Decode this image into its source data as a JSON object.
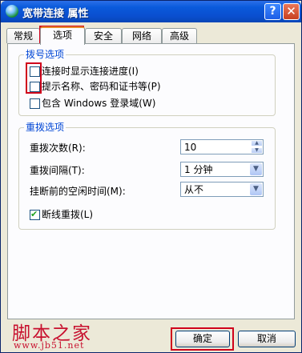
{
  "window": {
    "title": "宽带连接 属性",
    "help_glyph": "?",
    "close_glyph": "✕"
  },
  "tabs": [
    {
      "label": "常规"
    },
    {
      "label": "选项",
      "active": true
    },
    {
      "label": "安全"
    },
    {
      "label": "网络"
    },
    {
      "label": "高级"
    }
  ],
  "dial_options": {
    "title": "拨号选项",
    "items": [
      {
        "label": "连接时显示连接进度(I)",
        "checked": false
      },
      {
        "label": "提示名称、密码和证书等(P)",
        "checked": false
      },
      {
        "label": "包含 Windows 登录域(W)",
        "checked": false
      }
    ]
  },
  "redial_options": {
    "title": "重拨选项",
    "attempts_label": "重拨次数(R):",
    "attempts_value": "10",
    "interval_label": "重拨间隔(T):",
    "interval_value": "1 分钟",
    "idle_label": "挂断前的空闲时间(M):",
    "idle_value": "从不",
    "redial_if_dropped": {
      "label": "断线重拨(L)",
      "checked": true
    }
  },
  "buttons": {
    "ok": "确定",
    "cancel": "取消"
  },
  "watermark": {
    "main": "脚本之家",
    "url": "www.jb51.net"
  },
  "colors": {
    "highlight_box": "#d0021b",
    "group_title": "#0046d5",
    "titlebar": "#0a5adb"
  }
}
